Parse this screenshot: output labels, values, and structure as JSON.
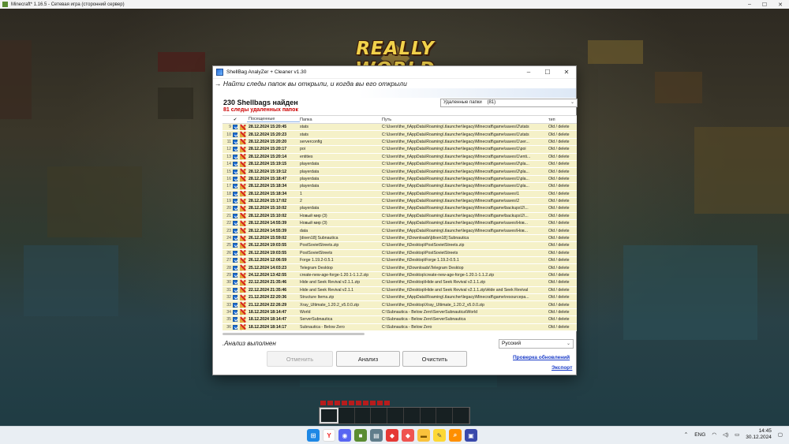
{
  "mc": {
    "title": "Minecraft* 1.16.5 - Сетевая игра (сторонний сервер)",
    "logo": "REALLY WORLD"
  },
  "app": {
    "title": "ShellBag  AnalyZer + Cleaner v1.30",
    "tagline": "→ Найти следы папок вы открыли, и когда вы его открыли",
    "found": "230 Shellbags найден",
    "deleted_found": "81  следы удаленных папок",
    "filter": {
      "label": "Удаленные папки",
      "count": "(81)"
    },
    "columns": {
      "check": "✔",
      "visited": "Посещенные",
      "folder": "Папка",
      "path": "Путь",
      "type": "тип"
    },
    "rows": [
      {
        "n": "9",
        "date": "28.12.2024 15:20:45",
        "folder": "stats",
        "path": "C:\\Users\\the_t\\AppData\\Roaming\\.tlauncher\\legacy\\Minecraft\\game\\saves\\2\\stats",
        "type": "Old / delete"
      },
      {
        "n": "10",
        "date": "28.12.2024 15:20:23",
        "folder": "stats",
        "path": "C:\\Users\\the_t\\AppData\\Roaming\\.tlauncher\\legacy\\Minecraft\\game\\saves\\1\\stats",
        "type": "Old / delete"
      },
      {
        "n": "11",
        "date": "28.12.2024 15:20:20",
        "folder": "serverconfig",
        "path": "C:\\Users\\the_t\\AppData\\Roaming\\.tlauncher\\legacy\\Minecraft\\game\\saves\\1\\ser...",
        "type": "Old / delete"
      },
      {
        "n": "12",
        "date": "28.12.2024 15:20:17",
        "folder": "poi",
        "path": "C:\\Users\\the_t\\AppData\\Roaming\\.tlauncher\\legacy\\Minecraft\\game\\saves\\1\\poi",
        "type": "Old / delete"
      },
      {
        "n": "13",
        "date": "28.12.2024 15:20:14",
        "folder": "entities",
        "path": "C:\\Users\\the_t\\AppData\\Roaming\\.tlauncher\\legacy\\Minecraft\\game\\saves\\1\\enti...",
        "type": "Old / delete"
      },
      {
        "n": "14",
        "date": "28.12.2024 15:19:15",
        "folder": "playerdata",
        "path": "C:\\Users\\the_t\\AppData\\Roaming\\.tlauncher\\legacy\\Minecraft\\game\\saves\\2\\pla...",
        "type": "Old / delete"
      },
      {
        "n": "15",
        "date": "28.12.2024 15:19:12",
        "folder": "playerdata",
        "path": "C:\\Users\\the_t\\AppData\\Roaming\\.tlauncher\\legacy\\Minecraft\\game\\saves\\2\\pla...",
        "type": "Old / delete"
      },
      {
        "n": "16",
        "date": "28.12.2024 15:18:47",
        "folder": "playerdata",
        "path": "C:\\Users\\the_t\\AppData\\Roaming\\.tlauncher\\legacy\\Minecraft\\game\\saves\\1\\pla...",
        "type": "Old / delete"
      },
      {
        "n": "17",
        "date": "28.12.2024 15:18:34",
        "folder": "playerdata",
        "path": "C:\\Users\\the_t\\AppData\\Roaming\\.tlauncher\\legacy\\Minecraft\\game\\saves\\1\\pla...",
        "type": "Old / delete"
      },
      {
        "n": "18",
        "date": "28.12.2024 15:18:34",
        "folder": "1",
        "path": "C:\\Users\\the_t\\AppData\\Roaming\\.tlauncher\\legacy\\Minecraft\\game\\saves\\1",
        "type": "Old / delete"
      },
      {
        "n": "19",
        "date": "28.12.2024 15:17:02",
        "folder": "2",
        "path": "C:\\Users\\the_t\\AppData\\Roaming\\.tlauncher\\legacy\\Minecraft\\game\\saves\\2",
        "type": "Old / delete"
      },
      {
        "n": "20",
        "date": "28.12.2024 15:10:02",
        "folder": "playerdata",
        "path": "C:\\Users\\the_t\\AppData\\Roaming\\.tlauncher\\legacy\\Minecraft\\game\\backups\\2\\...",
        "type": "Old / delete"
      },
      {
        "n": "21",
        "date": "28.12.2024 15:10:02",
        "folder": "Новый мир (3)",
        "path": "C:\\Users\\the_t\\AppData\\Roaming\\.tlauncher\\legacy\\Minecraft\\game\\backups\\2\\...",
        "type": "Old / delete"
      },
      {
        "n": "22",
        "date": "28.12.2024 14:55:39",
        "folder": "Новый мир (3)",
        "path": "C:\\Users\\the_t\\AppData\\Roaming\\.tlauncher\\legacy\\Minecraft\\game\\saves\\Нов...",
        "type": "Old / delete"
      },
      {
        "n": "23",
        "date": "28.12.2024 14:55:39",
        "folder": "data",
        "path": "C:\\Users\\the_t\\AppData\\Roaming\\.tlauncher\\legacy\\Minecraft\\game\\saves\\Нов...",
        "type": "Old / delete"
      },
      {
        "n": "24",
        "date": "26.12.2024 15:59:02",
        "folder": "[dixen18] Subnautica",
        "path": "C:\\Users\\the_t\\Downloads\\[dixen18] Subnautica",
        "type": "Old / delete"
      },
      {
        "n": "25",
        "date": "26.12.2024 19:03:55",
        "folder": "PostSovietStreets.zip",
        "path": "C:\\Users\\the_t\\Desktop\\PostSovietStreets.zip",
        "type": "Old / delete"
      },
      {
        "n": "26",
        "date": "26.12.2024 19:03:55",
        "folder": "PostSovietStreets",
        "path": "C:\\Users\\the_t\\Desktop\\PostSovietStreets",
        "type": "Old / delete"
      },
      {
        "n": "27",
        "date": "26.12.2024 12:06:59",
        "folder": "Forge 1.19.2-0.5.1",
        "path": "C:\\Users\\the_t\\Desktop\\Forge 1.19.2-0.5.1",
        "type": "Old / delete"
      },
      {
        "n": "28",
        "date": "25.12.2024 14:03:23",
        "folder": "Telegram Desktop",
        "path": "C:\\Users\\the_t\\Downloads\\Telegram Desktop",
        "type": "Old / delete"
      },
      {
        "n": "29",
        "date": "24.12.2024 13:42:55",
        "folder": "create-new-age-forge-1.20.1-1.1.2.zip",
        "path": "C:\\Users\\the_t\\Desktop\\create-new-age-forge-1.20.1-1.1.2.zip",
        "type": "Old / delete"
      },
      {
        "n": "30",
        "date": "22.12.2024 21:35:46",
        "folder": "Hide and Seek Revival v2.1.1.zip",
        "path": "C:\\Users\\the_t\\Desktop\\Hide and Seek Revival v2.1.1.zip",
        "type": "Old / delete"
      },
      {
        "n": "31",
        "date": "22.12.2024 21:35:46",
        "folder": "Hide and Seek Revival v2.1.1",
        "path": "C:\\Users\\the_t\\Desktop\\Hide and Seek Revival v2.1.1.zip\\Hide and Seek Revival",
        "type": "Old / delete"
      },
      {
        "n": "32",
        "date": "21.12.2024 22:20:36",
        "folder": "Structure Items.zip",
        "path": "C:\\Users\\the_t\\AppData\\Roaming\\.tlauncher\\legacy\\Minecraft\\game\\resourcepa...",
        "type": "Old / delete"
      },
      {
        "n": "33",
        "date": "21.12.2024 22:26:29",
        "folder": "Xray_Ultimate_1.20.2_v5.0.0.zip",
        "path": "C:\\Users\\the_t\\Desktop\\Xray_Ultimate_1.20.2_v5.0.0.zip",
        "type": "Old / delete"
      },
      {
        "n": "34",
        "date": "18.12.2024 18:14:47",
        "folder": "World",
        "path": "C:\\Subnautica - Below Zero\\ServerSubnautica\\World",
        "type": "Old / delete"
      },
      {
        "n": "35",
        "date": "18.12.2024 18:14:47",
        "folder": "ServerSubnautica",
        "path": "C:\\Subnautica - Below Zero\\ServerSubnautica",
        "type": "Old / delete"
      },
      {
        "n": "36",
        "date": "18.12.2024 18:14:17",
        "folder": "Subnautica - Below Zero",
        "path": "C:\\Subnautica - Below Zero",
        "type": "Old / delete"
      }
    ],
    "status": ".Анализ выполнен",
    "language": "Русский",
    "buttons": {
      "cancel": "Отменить",
      "analyze": "Анализ",
      "clean": "Очистить"
    },
    "links": {
      "updates": "Проверка обновлений",
      "export": "Экспорт"
    }
  },
  "taskbar": {
    "lang": "ENG",
    "time": "14:45",
    "date": "30.12.2024",
    "apps": [
      "windows-start",
      "yandex-browser",
      "discord",
      "minecraft",
      "archive",
      "anydesk",
      "anydesk-2",
      "file-explorer",
      "notes",
      "search",
      "image-viewer"
    ]
  }
}
